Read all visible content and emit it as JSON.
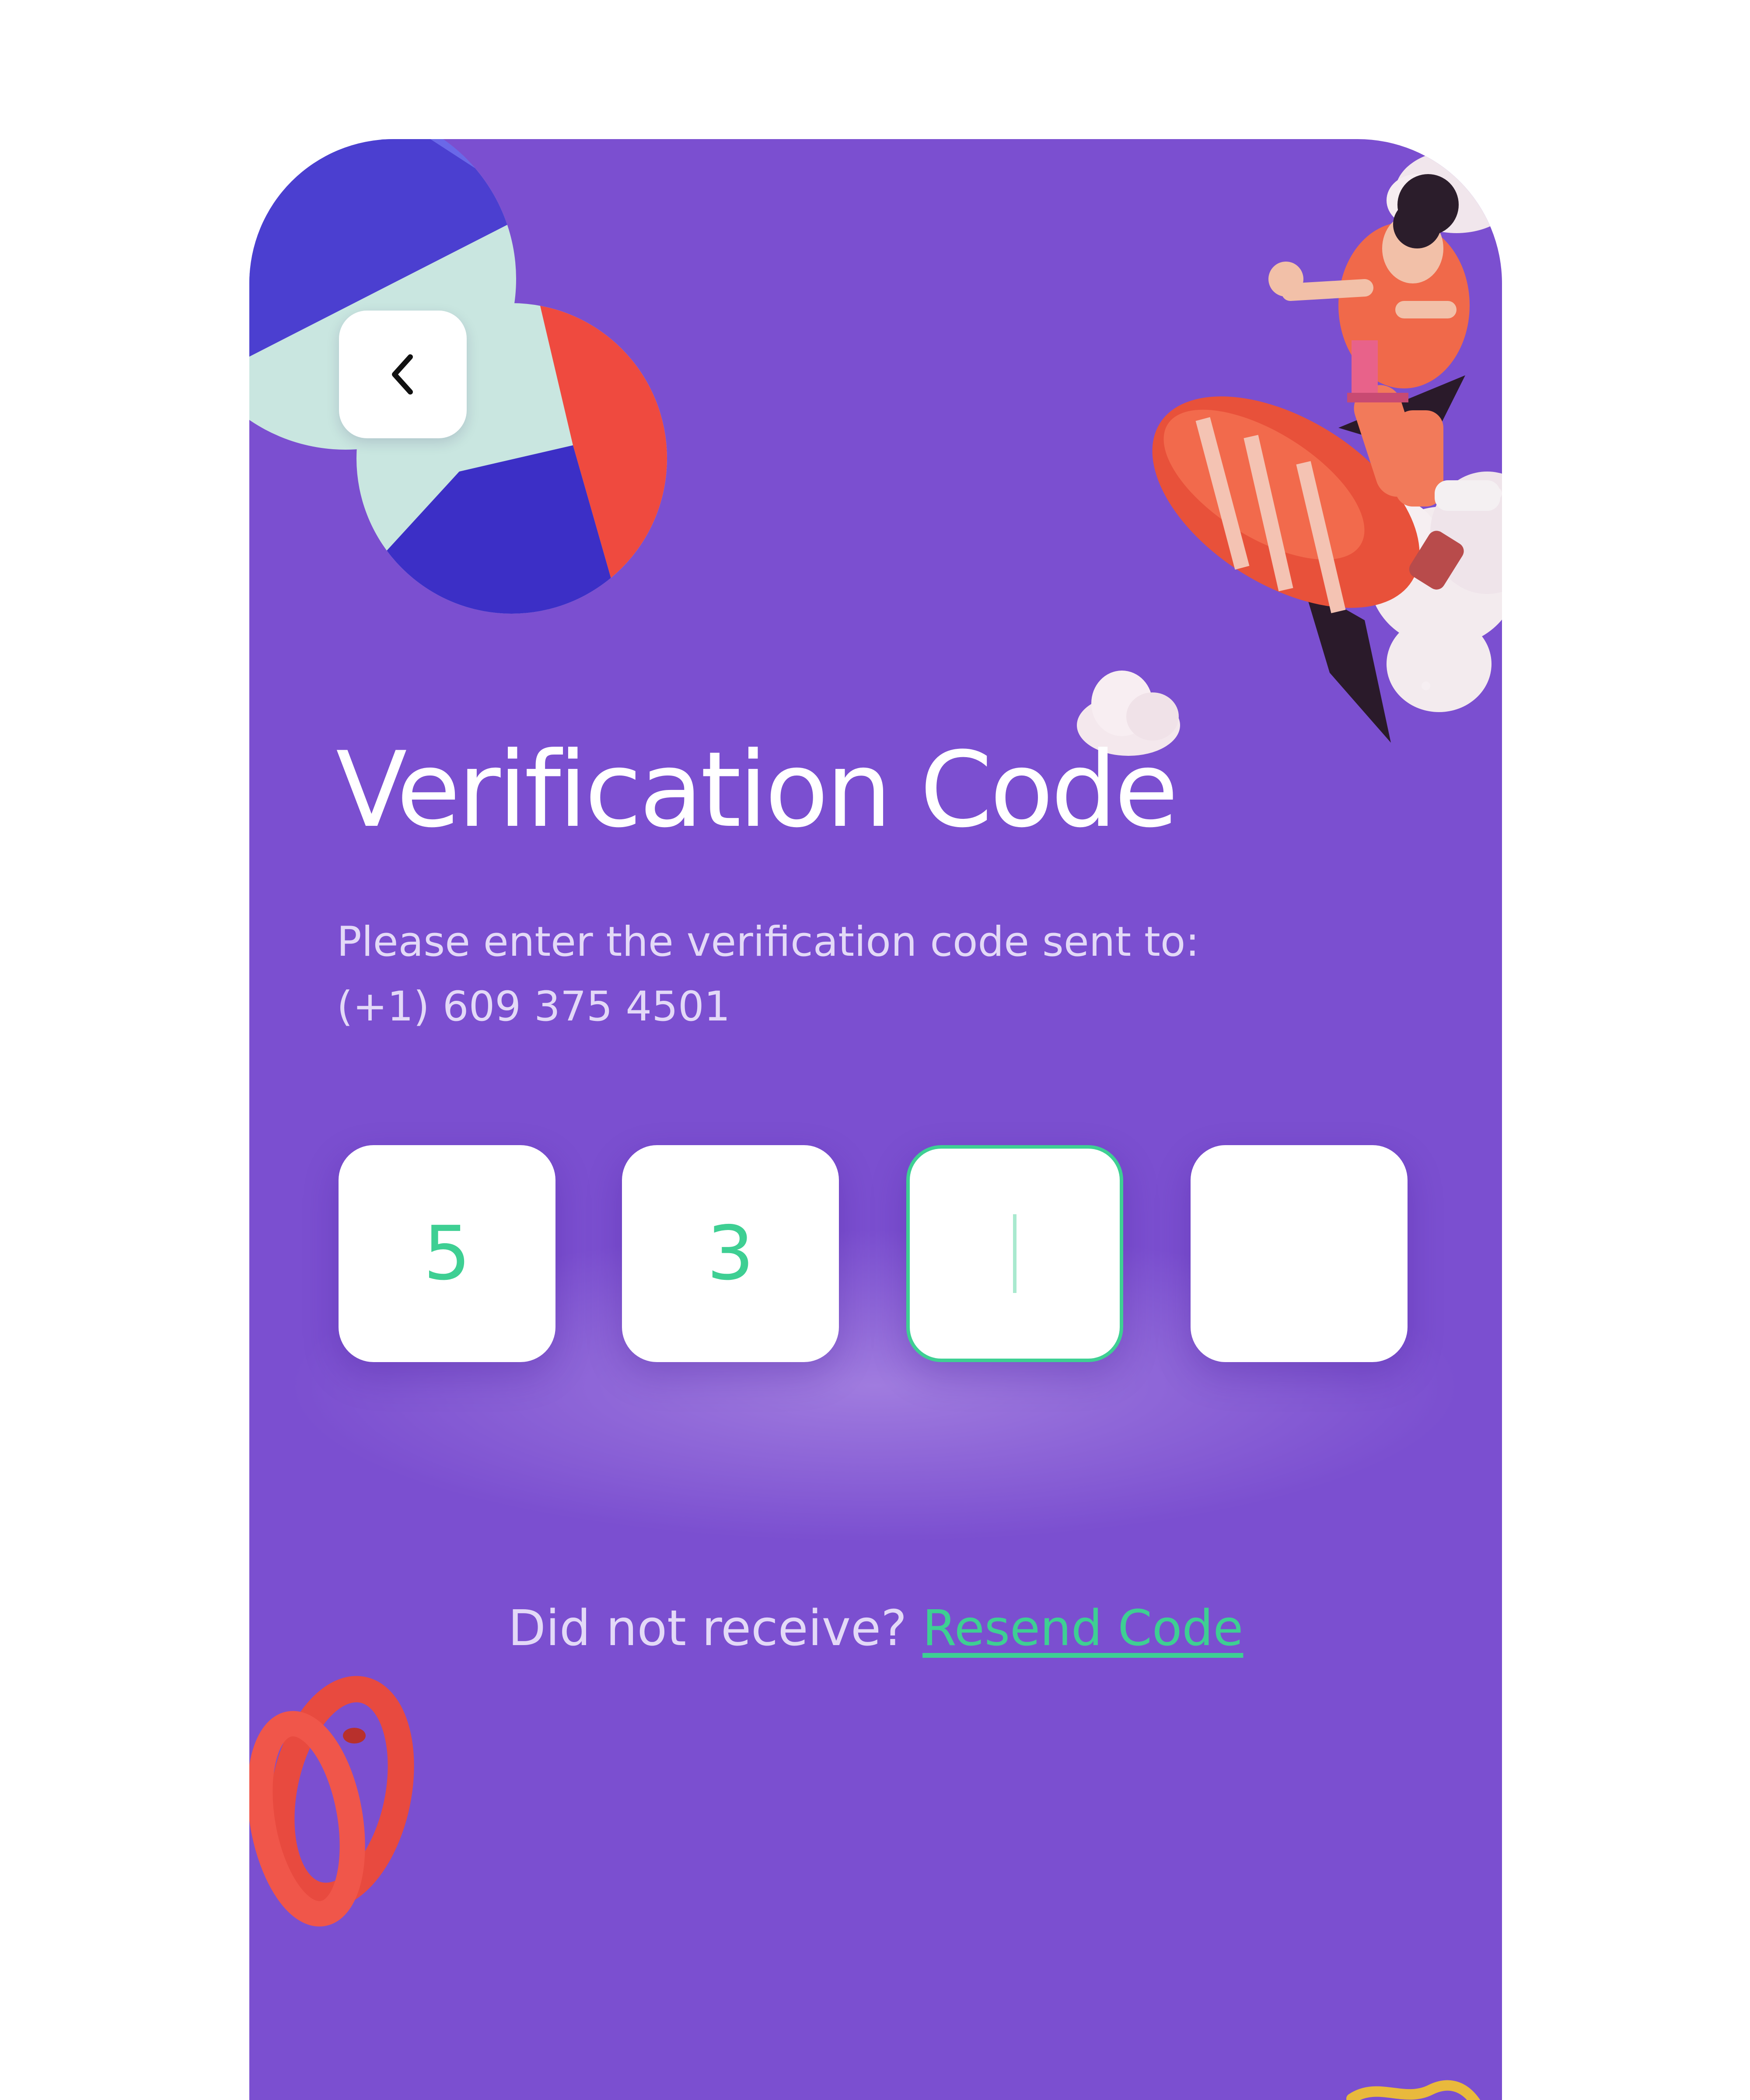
{
  "header": {
    "back_icon": "chevron-left-icon"
  },
  "main": {
    "title": "Verification Code",
    "subtitle_line1": "Please enter the verification code sent to:",
    "phone_number": "(+1) 609 375 4501"
  },
  "otp": {
    "digits": [
      "5",
      "3",
      "",
      ""
    ],
    "active_index": 2
  },
  "resend": {
    "prompt": "Did not receive?",
    "link_label": "Resend Code"
  },
  "colors": {
    "background": "#7b4fd0",
    "accent": "#3ecf93",
    "card": "#ffffff"
  }
}
